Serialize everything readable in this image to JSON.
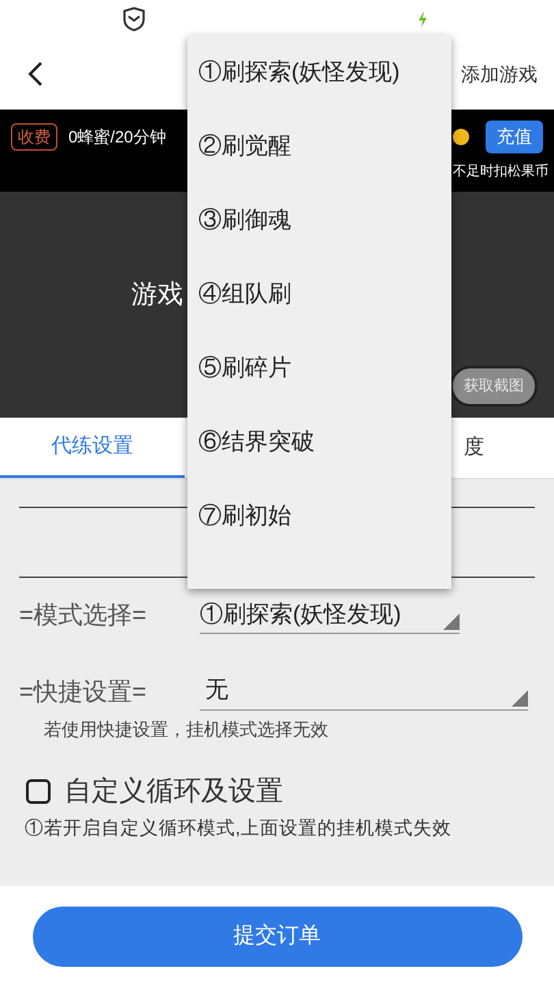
{
  "header": {
    "action": "添加游戏"
  },
  "billing": {
    "badge": "收费",
    "price": "0蜂蜜/20分钟",
    "recharge": "充值",
    "note": "不足时扣松果币"
  },
  "preview": {
    "title": "游戏",
    "capture_button": "获取截图"
  },
  "tabs": [
    {
      "label": "代练设置",
      "selected": true
    },
    {
      "label": "度",
      "selected": false
    }
  ],
  "form": {
    "mode_label": "=模式选择=",
    "mode_value": "①刷探索(妖怪发现)",
    "shortcut_label": "=快捷设置=",
    "shortcut_value": "无",
    "hint": "若使用快捷设置，挂机模式选择无效",
    "custom": {
      "label": "自定义循环及设置",
      "checked": false
    },
    "note": "①若开启自定义循环模式,上面设置的挂机模式失效"
  },
  "submit": "提交订单",
  "dropdown": {
    "items": [
      "①刷探索(妖怪发现)",
      "②刷觉醒",
      "③刷御魂",
      "④组队刷",
      "⑤刷碎片",
      "⑥结界突破",
      "⑦刷初始"
    ]
  }
}
